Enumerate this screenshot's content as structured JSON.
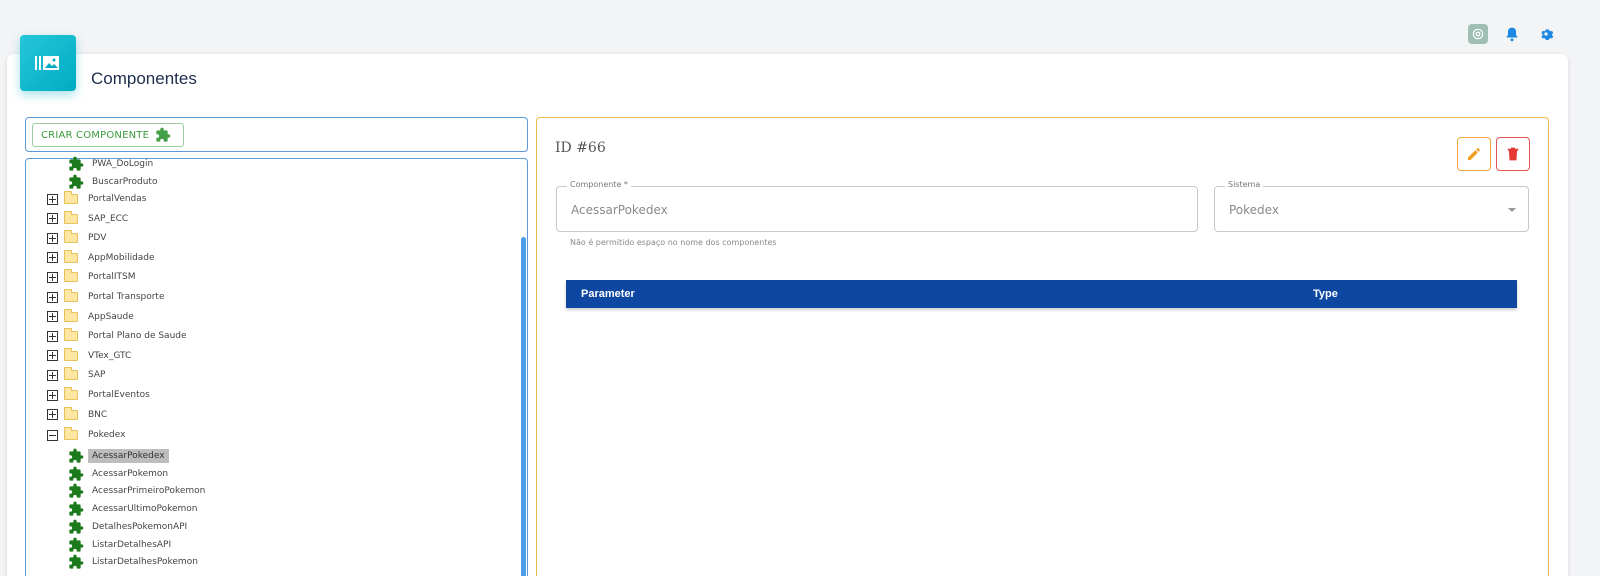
{
  "header": {
    "icons": [
      "openai-icon",
      "bell-icon",
      "gear-icon"
    ]
  },
  "page": {
    "title": "Componentes"
  },
  "toolbar": {
    "create_label": "CRIAR COMPONENTE"
  },
  "tree": {
    "top_leaves": [
      "PWA_DoLogin",
      "BuscarProduto"
    ],
    "folders": [
      "PortalVendas",
      "SAP_ECC",
      "PDV",
      "AppMobilidade",
      "PortalITSM",
      "Portal Transporte",
      "AppSaude",
      "Portal Plano de Saude",
      "VTex_GTC",
      "SAP",
      "PortalEventos",
      "BNC"
    ],
    "open_folder": "Pokedex",
    "open_leaves": [
      "AcessarPokedex",
      "AcessarPokemon",
      "AcessarPrimeiroPokemon",
      "AcessarUltimoPokemon",
      "DetalhesPokemonAPI",
      "ListarDetalhesAPI",
      "ListarDetalhesPokemon"
    ],
    "selected": "AcessarPokedex"
  },
  "detail": {
    "id_label": "ID #66",
    "component_label": "Componente *",
    "component_value": "AcessarPokedex",
    "system_label": "Sistema",
    "system_value": "Pokedex",
    "hint": "Não é permitido espaço no nome dos componentes",
    "table_headers": {
      "parameter": "Parameter",
      "type": "Type"
    }
  },
  "colors": {
    "accent": "#00acc1",
    "tree_border": "#5a9bd8",
    "detail_border": "#f0b94a",
    "table_header": "#0d47a1",
    "puzzle_green": "#1b7a1b"
  }
}
